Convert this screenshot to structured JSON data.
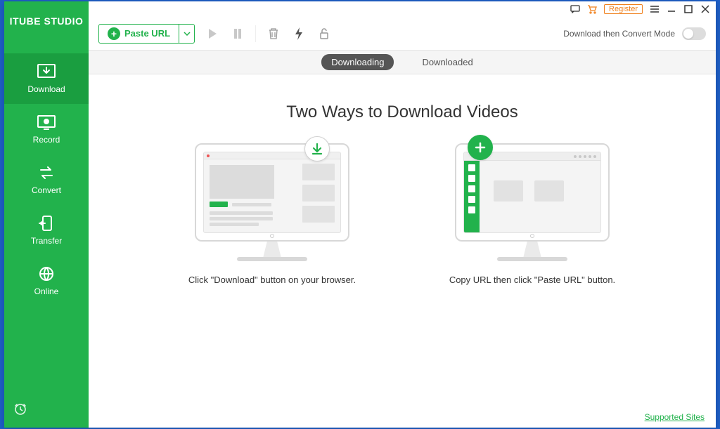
{
  "brand": "ITUBE STUDIO",
  "sidebar": {
    "items": [
      {
        "label": "Download"
      },
      {
        "label": "Record"
      },
      {
        "label": "Convert"
      },
      {
        "label": "Transfer"
      },
      {
        "label": "Online"
      }
    ]
  },
  "titlebar": {
    "register": "Register"
  },
  "toolbar": {
    "paste_url": "Paste URL",
    "convert_mode": "Download then Convert Mode"
  },
  "tabs": {
    "downloading": "Downloading",
    "downloaded": "Downloaded"
  },
  "content": {
    "headline": "Two Ways to Download Videos",
    "method_a_caption": "Click \"Download\" button on your browser.",
    "method_b_caption": "Copy URL then click \"Paste URL\" button.",
    "supported_sites": "Supported Sites"
  }
}
